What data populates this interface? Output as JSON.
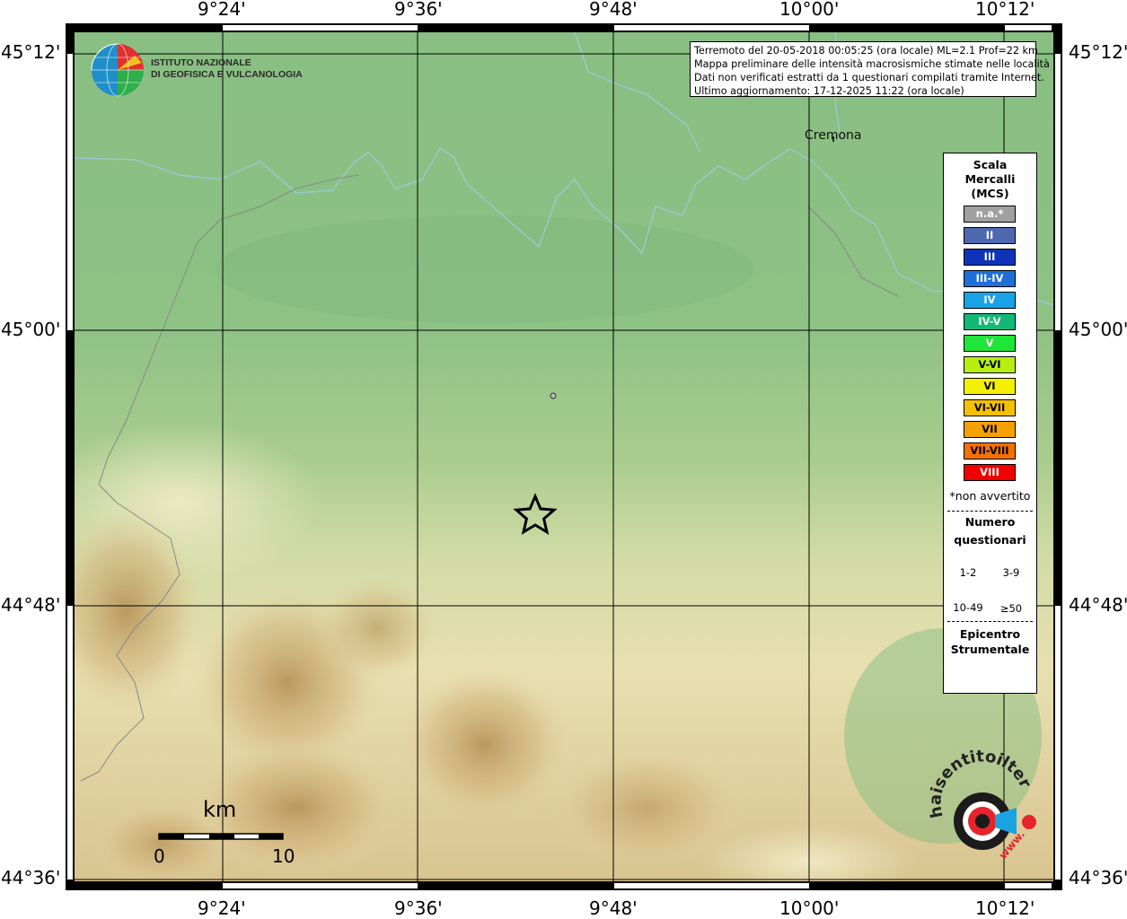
{
  "map": {
    "top_ticks": [
      "9°24'",
      "9°36'",
      "9°48'",
      "10°00'",
      "10°12'"
    ],
    "bottom_ticks": [
      "9°24'",
      "9°36'",
      "9°48'",
      "10°00'",
      "10°12'"
    ],
    "left_ticks": [
      "45°12'",
      "45°00'",
      "44°48'",
      "44°36'"
    ],
    "right_ticks": [
      "45°12'",
      "45°00'",
      "44°48'",
      "44°36'"
    ],
    "city": "Cremona",
    "river_color": "#9ec9dc",
    "epicenter_marker": "star-icon"
  },
  "header": {
    "org_line1": "ISTITUTO NAZIONALE",
    "org_line2": "DI GEOFISICA E VULCANOLOGIA",
    "info": [
      "Terremoto del 20-05-2018 00:05:25 (ora locale) ML=2.1 Prof=22 km",
      "Mappa preliminare delle intensità macrosismiche stimate nelle località",
      "Dati non verificati estratti da 1 questionari compilati tramite Internet.",
      "Ultimo aggiornamento: 17-12-2025 11:22 (ora locale)"
    ]
  },
  "legend": {
    "title1": "Scala",
    "title2": "Mercalli",
    "title3": "(MCS)",
    "items": [
      {
        "label": "n.a.*",
        "color": "#a0a0a0"
      },
      {
        "label": "II",
        "color": "#4e68b0"
      },
      {
        "label": "III",
        "color": "#0f33b8"
      },
      {
        "label": "III-IV",
        "color": "#1e6fd8"
      },
      {
        "label": "IV",
        "color": "#19a2e6"
      },
      {
        "label": "IV-V",
        "color": "#14b876"
      },
      {
        "label": "V",
        "color": "#1ee638"
      },
      {
        "label": "V-VI",
        "color": "#b6ef10"
      },
      {
        "label": "VI",
        "color": "#f5f000"
      },
      {
        "label": "VI-VII",
        "color": "#f5c000"
      },
      {
        "label": "VII",
        "color": "#f5a000"
      },
      {
        "label": "VII-VIII",
        "color": "#f57000"
      },
      {
        "label": "VIII",
        "color": "#f00000"
      }
    ],
    "na_note": "*non avvertito",
    "count_title1": "Numero",
    "count_title2": "questionari",
    "sizes": [
      "1-2",
      "3-9",
      "10-49",
      "≥50"
    ],
    "epi_title1": "Epicentro",
    "epi_title2": "Strumentale"
  },
  "scale": {
    "unit": "km",
    "start": "0",
    "end": "10"
  },
  "watermark": {
    "text": "haisentitoilterremoto.it",
    "url": "www."
  }
}
